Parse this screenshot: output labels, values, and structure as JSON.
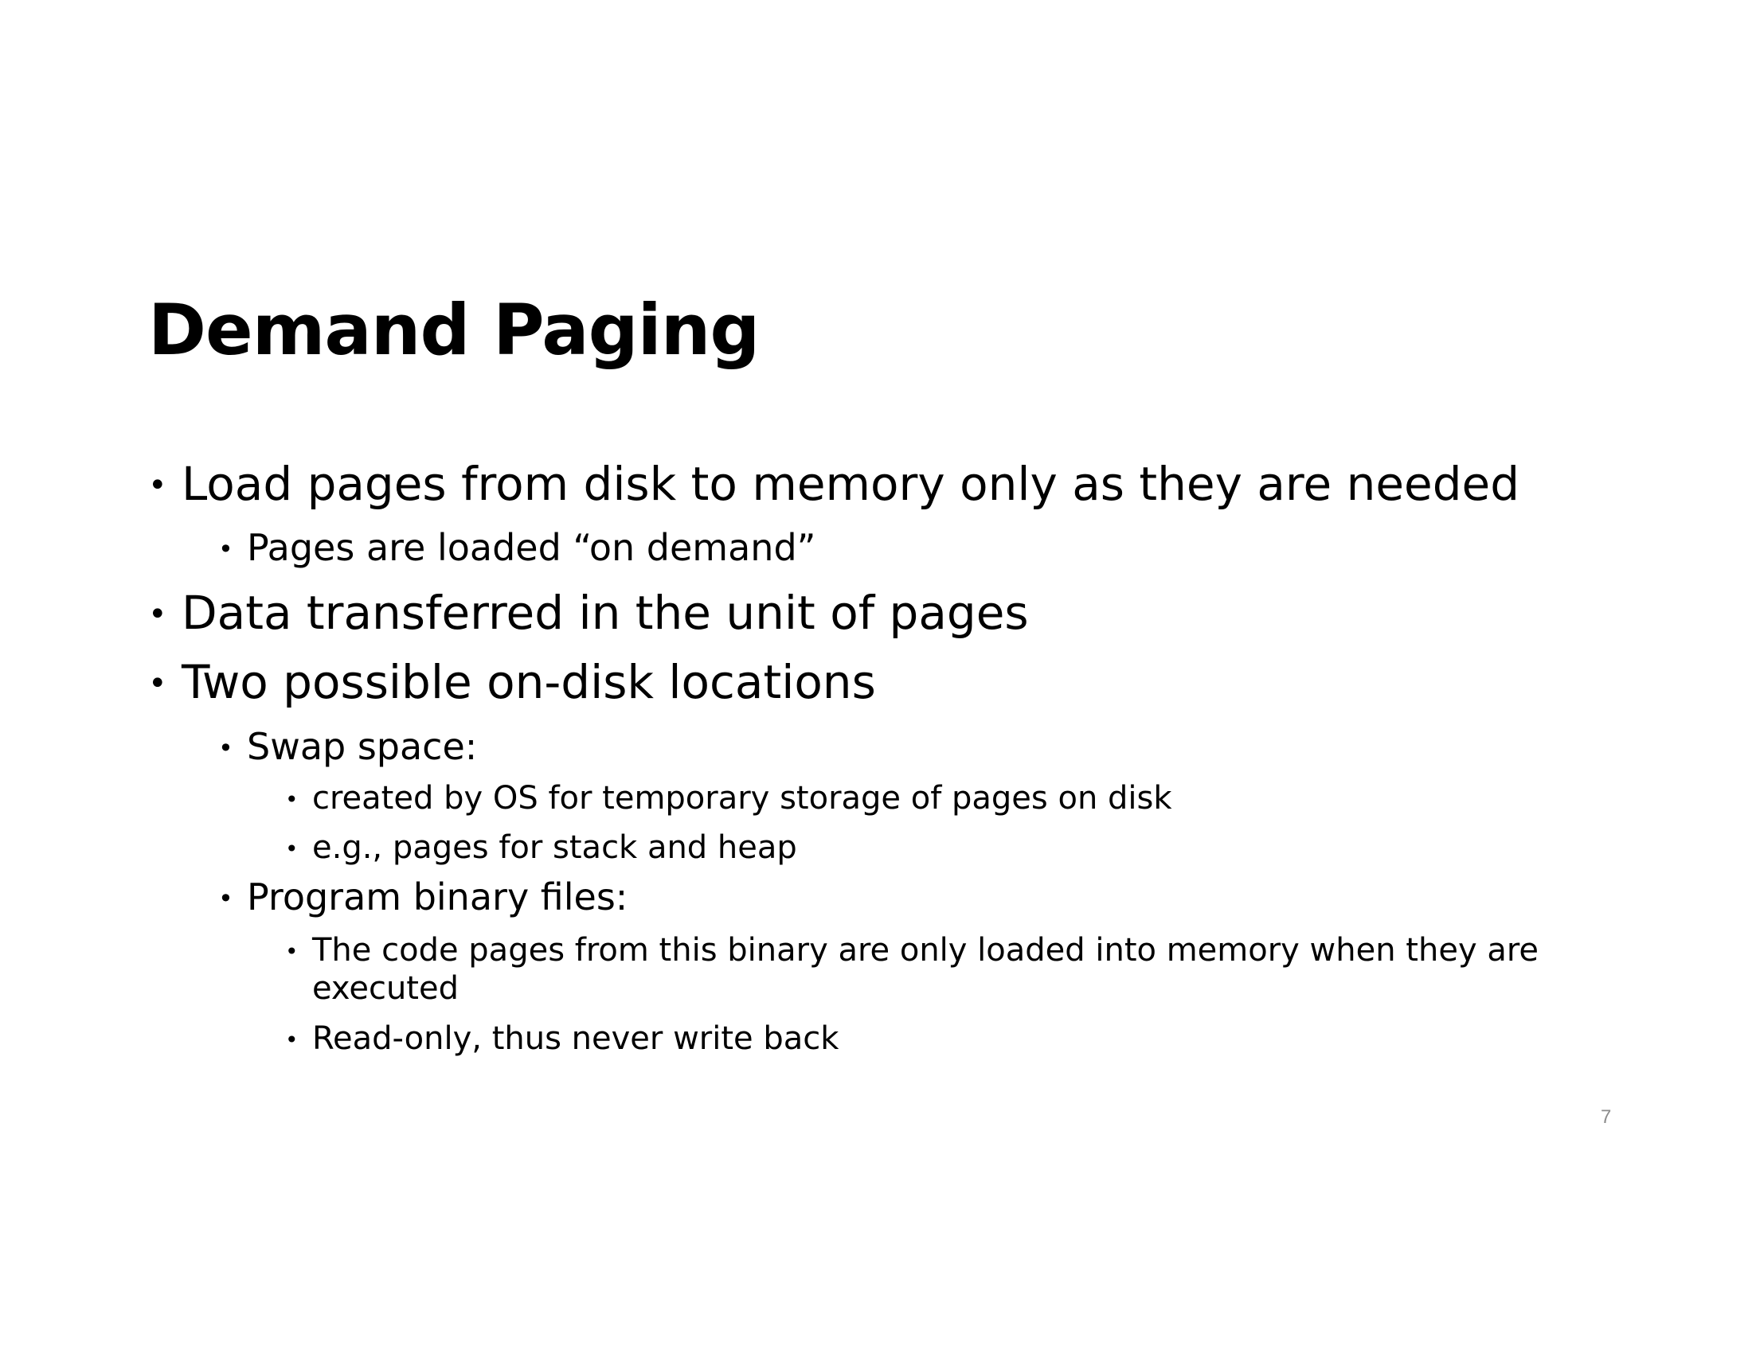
{
  "slide": {
    "title": "Demand Paging",
    "bullet_char": "•",
    "items": [
      {
        "text": "Load pages from disk to memory only as they are needed"
      },
      {
        "text": "Pages are loaded “on demand”"
      },
      {
        "text": "Data transferred in the unit of pages"
      },
      {
        "text": "Two possible on-disk locations"
      },
      {
        "text": "Swap space:"
      },
      {
        "text": "created by OS for temporary storage of pages on disk"
      },
      {
        "text": "e.g., pages for stack and heap"
      },
      {
        "text": "Program binary files:"
      },
      {
        "text": "The code pages from this binary are only loaded into memory when they are executed"
      },
      {
        "text": "Read-only, thus never write back"
      }
    ],
    "page_number": "7"
  }
}
